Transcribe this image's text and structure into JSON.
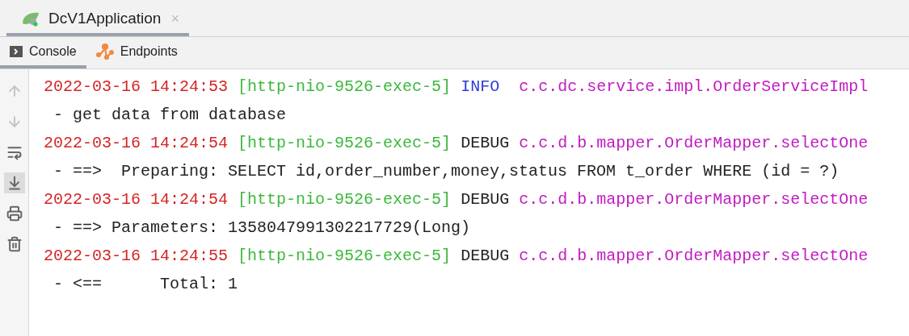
{
  "run_tabs": [
    {
      "label": "DcV1Application",
      "close": "×",
      "selected": true
    }
  ],
  "tool_tabs": [
    {
      "label": "Console",
      "kind": "console",
      "selected": true
    },
    {
      "label": "Endpoints",
      "kind": "endpoints",
      "selected": false
    }
  ],
  "gutter_tools": [
    {
      "kind": "up",
      "disabled": true,
      "on": false
    },
    {
      "kind": "down",
      "disabled": true,
      "on": false
    },
    {
      "kind": "wrap",
      "disabled": false,
      "on": false
    },
    {
      "kind": "scroll-end",
      "disabled": false,
      "on": true
    },
    {
      "kind": "print",
      "disabled": false,
      "on": false
    },
    {
      "kind": "clear",
      "disabled": false,
      "on": false
    }
  ],
  "log_lines": [
    {
      "kind": "header",
      "timestamp": "2022-03-16 14:24:53",
      "thread": "[http-nio-9526-exec-5]",
      "log_level": "INFO ",
      "color": "#2f3bd6",
      "logger": "c.c.dc.service.impl.OrderServiceImpl"
    },
    {
      "kind": "message",
      "text": " - get data from database"
    },
    {
      "kind": "header",
      "timestamp": "2022-03-16 14:24:54",
      "thread": "[http-nio-9526-exec-5]",
      "log_level": "DEBUG",
      "color": "#222222",
      "logger": "c.c.d.b.mapper.OrderMapper.selectOne"
    },
    {
      "kind": "message",
      "text": " - ==>  Preparing: SELECT id,order_number,money,status FROM t_order WHERE (id = ?)"
    },
    {
      "kind": "header",
      "timestamp": "2022-03-16 14:24:54",
      "thread": "[http-nio-9526-exec-5]",
      "log_level": "DEBUG",
      "color": "#222222",
      "logger": "c.c.d.b.mapper.OrderMapper.selectOne"
    },
    {
      "kind": "message",
      "text": " - ==> Parameters: 1358047991302217729(Long)"
    },
    {
      "kind": "header",
      "timestamp": "2022-03-16 14:24:55",
      "thread": "[http-nio-9526-exec-5]",
      "log_level": "DEBUG",
      "color": "#222222",
      "logger": "c.c.d.b.mapper.OrderMapper.selectOne"
    },
    {
      "kind": "message",
      "text": " - <==      Total: 1"
    }
  ]
}
